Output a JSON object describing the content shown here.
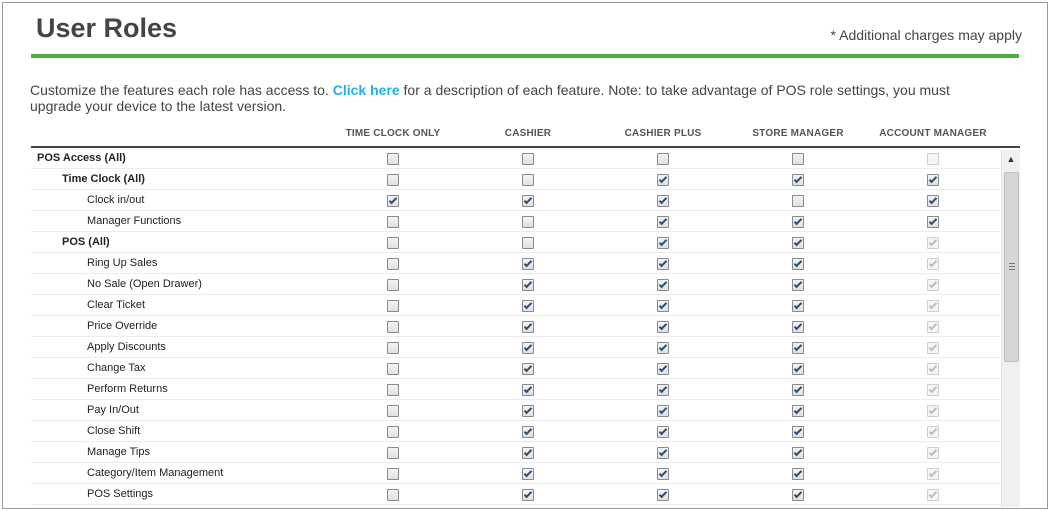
{
  "page": {
    "title": "User Roles",
    "charges_note": "* Additional charges may apply",
    "intro_before": "Customize the features each role has access to. ",
    "intro_link": "Click here",
    "intro_after": " for a description of each feature. Note: to take advantage of POS role settings, you must upgrade your device to the latest version."
  },
  "colors": {
    "accent_rule": "#4caf3f",
    "link": "#22b0e8",
    "check": "#2b4f77"
  },
  "columns": [
    "TIME CLOCK ONLY",
    "CASHIER",
    "CASHIER PLUS",
    "STORE MANAGER",
    "ACCOUNT MANAGER"
  ],
  "rows": [
    {
      "label": "POS Access (All)",
      "level": 0,
      "checks": [
        false,
        false,
        false,
        false,
        false
      ],
      "disabled": [
        false,
        false,
        false,
        false,
        true
      ]
    },
    {
      "label": "Time Clock (All)",
      "level": 1,
      "checks": [
        false,
        false,
        true,
        true,
        true
      ],
      "disabled": [
        false,
        false,
        false,
        false,
        false
      ]
    },
    {
      "label": "Clock in/out",
      "level": 2,
      "checks": [
        true,
        true,
        true,
        false,
        true
      ],
      "disabled": [
        false,
        false,
        false,
        false,
        false
      ]
    },
    {
      "label": "Manager Functions",
      "level": 2,
      "checks": [
        false,
        false,
        true,
        true,
        true
      ],
      "disabled": [
        false,
        false,
        false,
        false,
        false
      ]
    },
    {
      "label": "POS (All)",
      "level": 1,
      "checks": [
        false,
        false,
        true,
        true,
        true
      ],
      "disabled": [
        false,
        false,
        false,
        false,
        true
      ]
    },
    {
      "label": "Ring Up Sales",
      "level": 2,
      "checks": [
        false,
        true,
        true,
        true,
        true
      ],
      "disabled": [
        false,
        false,
        false,
        false,
        true
      ]
    },
    {
      "label": "No Sale (Open Drawer)",
      "level": 2,
      "checks": [
        false,
        true,
        true,
        true,
        true
      ],
      "disabled": [
        false,
        false,
        false,
        false,
        true
      ]
    },
    {
      "label": "Clear Ticket",
      "level": 2,
      "checks": [
        false,
        true,
        true,
        true,
        true
      ],
      "disabled": [
        false,
        false,
        false,
        false,
        true
      ]
    },
    {
      "label": "Price Override",
      "level": 2,
      "checks": [
        false,
        true,
        true,
        true,
        true
      ],
      "disabled": [
        false,
        false,
        false,
        false,
        true
      ]
    },
    {
      "label": "Apply Discounts",
      "level": 2,
      "checks": [
        false,
        true,
        true,
        true,
        true
      ],
      "disabled": [
        false,
        false,
        false,
        false,
        true
      ]
    },
    {
      "label": "Change Tax",
      "level": 2,
      "checks": [
        false,
        true,
        true,
        true,
        true
      ],
      "disabled": [
        false,
        false,
        false,
        false,
        true
      ]
    },
    {
      "label": "Perform Returns",
      "level": 2,
      "checks": [
        false,
        true,
        true,
        true,
        true
      ],
      "disabled": [
        false,
        false,
        false,
        false,
        true
      ]
    },
    {
      "label": "Pay In/Out",
      "level": 2,
      "checks": [
        false,
        true,
        true,
        true,
        true
      ],
      "disabled": [
        false,
        false,
        false,
        false,
        true
      ]
    },
    {
      "label": "Close Shift",
      "level": 2,
      "checks": [
        false,
        true,
        true,
        true,
        true
      ],
      "disabled": [
        false,
        false,
        false,
        false,
        true
      ]
    },
    {
      "label": "Manage Tips",
      "level": 2,
      "checks": [
        false,
        true,
        true,
        true,
        true
      ],
      "disabled": [
        false,
        false,
        false,
        false,
        true
      ]
    },
    {
      "label": "Category/Item Management",
      "level": 2,
      "checks": [
        false,
        true,
        true,
        true,
        true
      ],
      "disabled": [
        false,
        false,
        false,
        false,
        true
      ]
    },
    {
      "label": "POS Settings",
      "level": 2,
      "checks": [
        false,
        true,
        true,
        true,
        true
      ],
      "disabled": [
        false,
        false,
        false,
        false,
        true
      ]
    }
  ]
}
